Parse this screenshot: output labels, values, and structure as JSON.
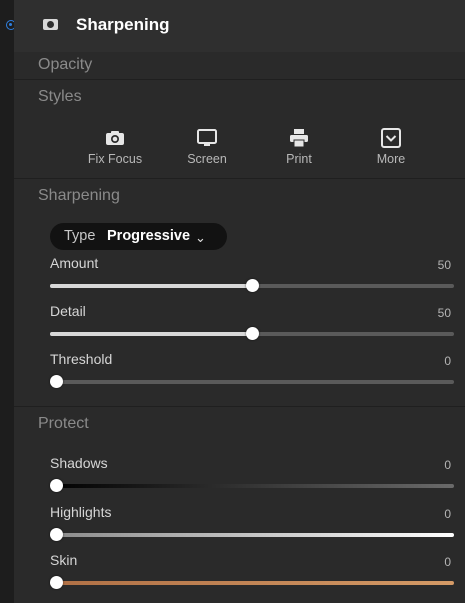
{
  "header": {
    "title": "Sharpening",
    "enabled": true
  },
  "sections": {
    "opacity": "Opacity",
    "styles": "Styles",
    "sharpening": "Sharpening",
    "protect": "Protect"
  },
  "styles": [
    {
      "label": "Fix Focus",
      "icon": "camera-icon"
    },
    {
      "label": "Screen",
      "icon": "monitor-icon"
    },
    {
      "label": "Print",
      "icon": "printer-icon"
    },
    {
      "label": "More",
      "icon": "dropdown-box-icon"
    }
  ],
  "type_selector": {
    "key": "Type",
    "value": "Progressive",
    "icon": "chevron-down-icon"
  },
  "sharpening_sliders": [
    {
      "label": "Amount",
      "value": "50",
      "fraction": 0.5
    },
    {
      "label": "Detail",
      "value": "50",
      "fraction": 0.5
    },
    {
      "label": "Threshold",
      "value": "0",
      "fraction": 0.0
    }
  ],
  "protect_sliders": [
    {
      "label": "Shadows",
      "value": "0",
      "fraction": 0.0,
      "track_style": "shadows-gradient"
    },
    {
      "label": "Highlights",
      "value": "0",
      "fraction": 0.0,
      "track_style": "highlights-gradient"
    },
    {
      "label": "Skin",
      "value": "0",
      "fraction": 0.0,
      "track_style": "skin-gradient"
    }
  ],
  "colors": {
    "accent": "#2f7fe0",
    "panel": "#2a2a2a",
    "skin": "#c98a5a"
  }
}
